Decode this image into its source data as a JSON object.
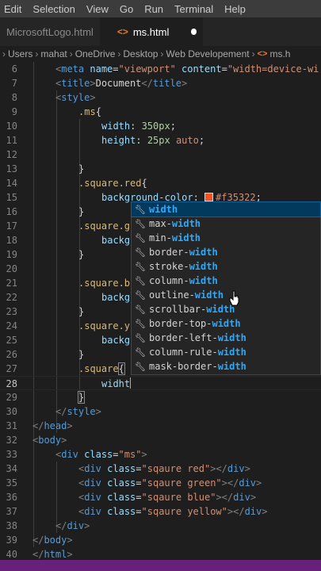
{
  "menu": [
    "Edit",
    "Selection",
    "View",
    "Go",
    "Run",
    "Terminal",
    "Help"
  ],
  "tabs": [
    {
      "label": "MicrosoftLogo.html",
      "active": false
    },
    {
      "label": "ms.html",
      "active": true,
      "icon": "<>",
      "modified": true
    }
  ],
  "breadcrumb": [
    "Users",
    "mahat",
    "OneDrive",
    "Desktop",
    "Web Developement",
    "ms.h"
  ],
  "breadcrumb_icon": "<>",
  "code": {
    "l6_lead": "<",
    "l6_tag": "meta",
    "l6_attr1": "name",
    "l6_eq1": "=",
    "l6_val1": "\"viewport\"",
    "l6_attr2": "content",
    "l6_eq2": "=",
    "l6_val2": "\"width=device-wi",
    "l7_open": "<",
    "l7_tag": "title",
    "l7_close": ">",
    "l7_text": "Document",
    "l7_endopen": "</",
    "l7_endtag": "title",
    "l7_endclose": ">",
    "l8_open": "<",
    "l8_tag": "style",
    "l8_close": ">",
    "l9_sel": ".ms",
    "l9_brace": "{",
    "l10_prop": "width",
    "l10_colon": ": ",
    "l10_val": "350px",
    "l10_semi": ";",
    "l11_prop": "height",
    "l11_colon": ": ",
    "l11_val": "25px",
    "l11_auto": " auto",
    "l11_semi": ";",
    "l13_brace": "}",
    "l14_sel": ".square.red",
    "l14_brace": "{",
    "l15_prop": "background-color",
    "l15_colon": ": ",
    "l15_val": "#f35322",
    "l15_semi": ";",
    "l16_brace": "}",
    "l17_sel": ".square.g",
    "l18_prop": "backg",
    "l19_brace": "}",
    "l21_sel": ".square.b",
    "l22_prop": "backg",
    "l23_brace": "}",
    "l24_sel": ".square.y",
    "l25_prop": "backg",
    "l26_brace": "}",
    "l27_sel": ".square",
    "l27_brace": "{",
    "l28_text": "widht",
    "l29_brace": "}",
    "l30_open": "</",
    "l30_tag": "style",
    "l30_close": ">",
    "l31_open": "</",
    "l31_tag": "head",
    "l31_close": ">",
    "l32_open": "<",
    "l32_tag": "body",
    "l32_close": ">",
    "l33_open": "<",
    "l33_tag": "div",
    "l33_attr": "class",
    "l33_eq": "=",
    "l33_val": "\"ms\"",
    "l33_close": ">",
    "l34_open": "<",
    "l34_tag": "div",
    "l34_attr": "class",
    "l34_eq": "=",
    "l34_val": "\"sqaure red\"",
    "l34_close": "></",
    "l34_endtag": "div",
    "l34_end": ">",
    "l35_open": "<",
    "l35_tag": "div",
    "l35_attr": "class",
    "l35_eq": "=",
    "l35_val": "\"sqaure green\"",
    "l35_close": "></",
    "l35_endtag": "div",
    "l35_end": ">",
    "l36_open": "<",
    "l36_tag": "div",
    "l36_attr": "class",
    "l36_eq": "=",
    "l36_val": "\"sqaure blue\"",
    "l36_close": "></",
    "l36_endtag": "div",
    "l36_end": ">",
    "l37_open": "<",
    "l37_tag": "div",
    "l37_attr": "class",
    "l37_eq": "=",
    "l37_val": "\"sqaure yellow\"",
    "l37_close": "></",
    "l37_endtag": "div",
    "l37_end": ">",
    "l38_open": "</",
    "l38_tag": "div",
    "l38_close": ">",
    "l39_open": "</",
    "l39_tag": "body",
    "l39_close": ">",
    "l40_open": "</",
    "l40_tag": "html",
    "l40_close": ">"
  },
  "line_numbers": [
    "6",
    "7",
    "8",
    "9",
    "10",
    "11",
    "12",
    "13",
    "14",
    "15",
    "16",
    "17",
    "18",
    "19",
    "20",
    "21",
    "22",
    "23",
    "24",
    "25",
    "26",
    "27",
    "28",
    "29",
    "30",
    "31",
    "32",
    "33",
    "34",
    "35",
    "36",
    "37",
    "38",
    "39",
    "40"
  ],
  "suggestions": [
    {
      "pre": "",
      "match": "width",
      "post": "",
      "selected": true
    },
    {
      "pre": "max-",
      "match": "width",
      "post": ""
    },
    {
      "pre": "min-",
      "match": "width",
      "post": ""
    },
    {
      "pre": "border-",
      "match": "width",
      "post": ""
    },
    {
      "pre": "stroke-",
      "match": "width",
      "post": ""
    },
    {
      "pre": "column-",
      "match": "width",
      "post": ""
    },
    {
      "pre": "outline-",
      "match": "width",
      "post": ""
    },
    {
      "pre": "scrollbar-",
      "match": "width",
      "post": ""
    },
    {
      "pre": "border-top-",
      "match": "width",
      "post": ""
    },
    {
      "pre": "border-left-",
      "match": "width",
      "post": ""
    },
    {
      "pre": "column-rule-",
      "match": "width",
      "post": ""
    },
    {
      "pre": "mask-border-",
      "match": "width",
      "post": ""
    }
  ],
  "suggestion_icon": "wrench-icon",
  "colors": {
    "accent": "#68217a",
    "swatch": "#f35322",
    "match_highlight": "#2aaaff"
  }
}
